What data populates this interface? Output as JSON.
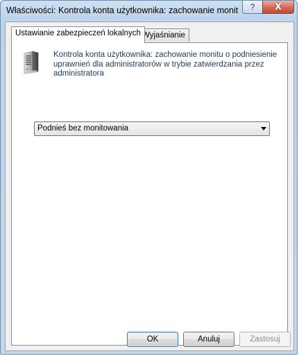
{
  "window": {
    "title": "Właściwości: Kontrola konta użytkownika: zachowanie monitu ...",
    "help_label": "?",
    "close_label": "X"
  },
  "tabs": [
    {
      "label": "Ustawianie zabezpieczeń lokalnych",
      "active": true
    },
    {
      "label": "Wyjaśnianie",
      "active": false
    }
  ],
  "policy": {
    "icon": "server-icon",
    "description": "Kontrola konta użytkownika: zachowanie monitu o podniesienie uprawnień dla administratorów w trybie zatwierdzania przez administratora",
    "selected_option": "Podnieś bez monitowania"
  },
  "buttons": {
    "ok": "OK",
    "cancel": "Anuluj",
    "apply": "Zastosuj"
  }
}
